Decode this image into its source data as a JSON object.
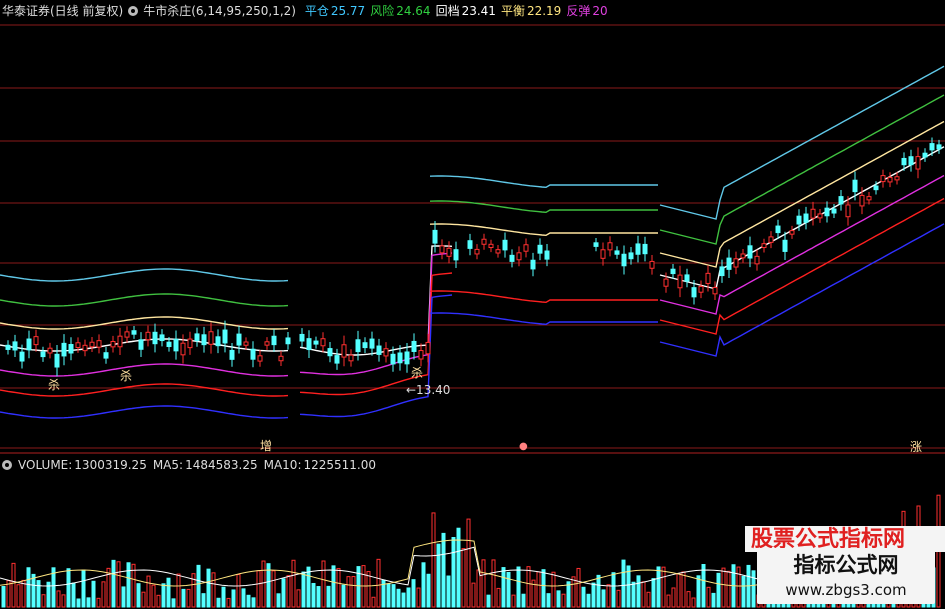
{
  "header": {
    "broker_title": "华泰证券(日线 前复权)",
    "indicator_name": "牛市杀庄(6,14,95,250,1,2)",
    "levels": [
      {
        "label": "平仓",
        "value": "25.77",
        "color": "#40c8ff"
      },
      {
        "label": "风险",
        "value": "24.64",
        "color": "#30d040"
      },
      {
        "label": "回档",
        "value": "23.41",
        "color": "#ffffff"
      },
      {
        "label": "平衡",
        "value": "22.19",
        "color": "#ffe680"
      },
      {
        "label": "反弹",
        "value": "20",
        "color": "#e040e0"
      }
    ]
  },
  "annotations": {
    "sell_labels": [
      "杀",
      "杀",
      "杀"
    ],
    "price_arrow": "←13.40",
    "zeng_label": "增",
    "zhang_label": "涨"
  },
  "volume": {
    "label": "VOLUME:",
    "value": "1300319.25",
    "ma5_label": "MA5:",
    "ma5_value": "1484583.25",
    "ma10_label": "MA10:",
    "ma10_value": "1225511.00"
  },
  "watermark": {
    "title": "指标公式网",
    "url": "www.zbgs3.com",
    "banner": "股票公式指标网"
  },
  "colors": {
    "bg": "#000000",
    "up": "#ff3030",
    "down": "#54ffff",
    "grid": "#8a1a1a",
    "band_lightblue": "#60c8e8",
    "band_green": "#40c040",
    "band_cream": "#ffe6a0",
    "band_white": "#ffffff",
    "band_magenta": "#e030e0",
    "band_red": "#ff2020",
    "band_blue": "#3030ff"
  }
}
